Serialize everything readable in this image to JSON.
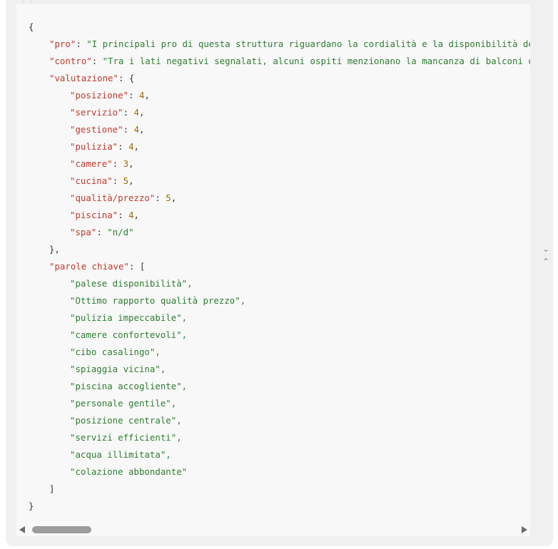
{
  "json_view": {
    "open_brace": "{",
    "close_brace": "}",
    "pro_key": "\"pro\"",
    "pro_value": "\"I principali pro di questa struttura riguardano la cordialità e la disponibilità del",
    "contro_key": "\"contro\"",
    "contro_value": "\"Tra i lati negativi segnalati, alcuni ospiti menzionano la mancanza di balconi o s",
    "valutazione_key": "\"valutazione\"",
    "valutazione": [
      {
        "key": "\"posizione\"",
        "value": "4",
        "sep": ","
      },
      {
        "key": "\"servizio\"",
        "value": "4",
        "sep": ","
      },
      {
        "key": "\"gestione\"",
        "value": "4",
        "sep": ","
      },
      {
        "key": "\"pulizia\"",
        "value": "4",
        "sep": ","
      },
      {
        "key": "\"camere\"",
        "value": "3",
        "sep": ","
      },
      {
        "key": "\"cucina\"",
        "value": "5",
        "sep": ","
      },
      {
        "key": "\"qualità/prezzo\"",
        "value": "5",
        "sep": ","
      },
      {
        "key": "\"piscina\"",
        "value": "4",
        "sep": ","
      },
      {
        "key": "\"spa\"",
        "value": "\"n/d\"",
        "sep": ""
      }
    ],
    "valutazione_close": "},",
    "parole_key": "\"parole chiave\"",
    "parole_open": "[",
    "parole_chiave": [
      "\"palese disponibilità\",",
      "\"Ottimo rapporto qualità prezzo\",",
      "\"pulizia impeccabile\",",
      "\"camere confortevoli\",",
      "\"cibo casalingo\",",
      "\"spiaggia vicina\",",
      "\"piscina accogliente\",",
      "\"personale gentile\",",
      "\"posizione centrale\",",
      "\"servizi efficienti\",",
      "\"acqua illimitata\",",
      "\"colazione abbondante\""
    ],
    "parole_close": "]"
  },
  "scrollbar": {
    "horizontal_position": 0
  },
  "icons": {
    "scroll_left": "triangle-left-icon",
    "scroll_right": "triangle-right-icon",
    "collapse": "chevron-down-icon",
    "expand": "chevron-up-icon"
  },
  "colors": {
    "key": "#c0392b",
    "string": "#2e7d32",
    "number": "#a06a00",
    "panel_bg": "#f8f8f8",
    "frame_bg": "#f0f0f0"
  }
}
